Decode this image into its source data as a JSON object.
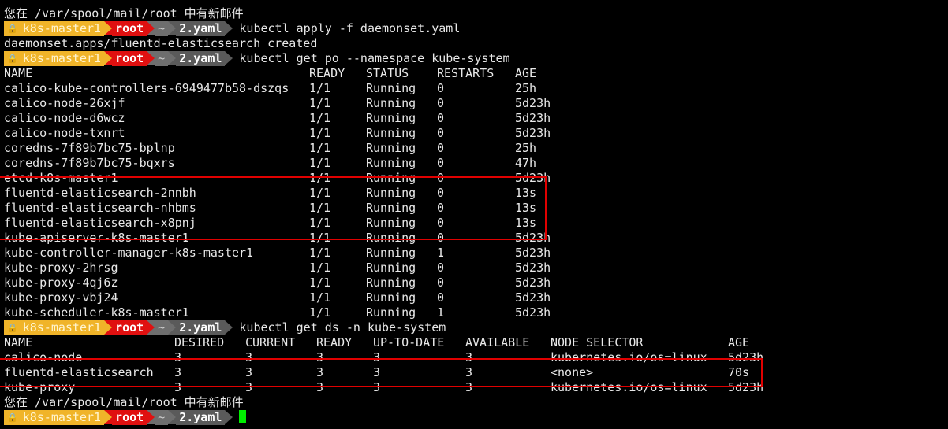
{
  "mail_notice": "您在 /var/spool/mail/root 中有新邮件",
  "prompt": {
    "lock_icon": "lock-icon",
    "host": "k8s-master1",
    "user": "root",
    "dir_home": "~",
    "dir_current": "2.yaml"
  },
  "commands": {
    "apply": "kubectl apply -f daemonset.yaml",
    "apply_output": "daemonset.apps/fluentd-elasticsearch created",
    "get_po": "kubectl get po --namespace kube-system",
    "get_ds": "kubectl get ds -n kube-system"
  },
  "pods_table": {
    "headers": [
      "NAME",
      "READY",
      "STATUS",
      "RESTARTS",
      "AGE"
    ],
    "rows": [
      [
        "calico-kube-controllers-6949477b58-dszqs",
        "1/1",
        "Running",
        "0",
        "25h"
      ],
      [
        "calico-node-26xjf",
        "1/1",
        "Running",
        "0",
        "5d23h"
      ],
      [
        "calico-node-d6wcz",
        "1/1",
        "Running",
        "0",
        "5d23h"
      ],
      [
        "calico-node-txnrt",
        "1/1",
        "Running",
        "0",
        "5d23h"
      ],
      [
        "coredns-7f89b7bc75-bplnp",
        "1/1",
        "Running",
        "0",
        "25h"
      ],
      [
        "coredns-7f89b7bc75-bqxrs",
        "1/1",
        "Running",
        "0",
        "47h"
      ],
      [
        "etcd-k8s-master1",
        "1/1",
        "Running",
        "0",
        "5d23h"
      ],
      [
        "fluentd-elasticsearch-2nnbh",
        "1/1",
        "Running",
        "0",
        "13s"
      ],
      [
        "fluentd-elasticsearch-nhbms",
        "1/1",
        "Running",
        "0",
        "13s"
      ],
      [
        "fluentd-elasticsearch-x8pnj",
        "1/1",
        "Running",
        "0",
        "13s"
      ],
      [
        "kube-apiserver-k8s-master1",
        "1/1",
        "Running",
        "0",
        "5d23h"
      ],
      [
        "kube-controller-manager-k8s-master1",
        "1/1",
        "Running",
        "1",
        "5d23h"
      ],
      [
        "kube-proxy-2hrsg",
        "1/1",
        "Running",
        "0",
        "5d23h"
      ],
      [
        "kube-proxy-4qj6z",
        "1/1",
        "Running",
        "0",
        "5d23h"
      ],
      [
        "kube-proxy-vbj24",
        "1/1",
        "Running",
        "0",
        "5d23h"
      ],
      [
        "kube-scheduler-k8s-master1",
        "1/1",
        "Running",
        "1",
        "5d23h"
      ]
    ]
  },
  "ds_table": {
    "headers": [
      "NAME",
      "DESIRED",
      "CURRENT",
      "READY",
      "UP-TO-DATE",
      "AVAILABLE",
      "NODE SELECTOR",
      "AGE"
    ],
    "rows": [
      [
        "calico-node",
        "3",
        "3",
        "3",
        "3",
        "3",
        "kubernetes.io/os=linux",
        "5d23h"
      ],
      [
        "fluentd-elasticsearch",
        "3",
        "3",
        "3",
        "3",
        "3",
        "<none>",
        "70s"
      ],
      [
        "kube-proxy",
        "3",
        "3",
        "3",
        "3",
        "3",
        "kubernetes.io/os=linux",
        "5d23h"
      ]
    ]
  },
  "colors": {
    "highlight_box": "#e00000",
    "cursor": "#00ee00",
    "prompt_host_bg": "#f0b429",
    "prompt_user_bg": "#e01010"
  }
}
